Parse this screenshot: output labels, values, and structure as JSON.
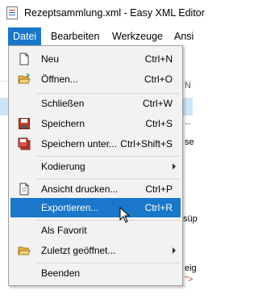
{
  "window": {
    "title": "Rezeptsammlung.xml - Easy XML Editor"
  },
  "menubar": {
    "items": [
      {
        "label": "Datei",
        "active": true
      },
      {
        "label": "Bearbeiten",
        "active": false
      },
      {
        "label": "Werkzeuge",
        "active": false
      },
      {
        "label": "Ansi",
        "active": false
      }
    ]
  },
  "background": {
    "snippets": [
      "N",
      "--",
      "se",
      "süp",
      "eig",
      "\">"
    ]
  },
  "menu": {
    "items": [
      {
        "label": "Neu",
        "shortcut": "Ctrl+N",
        "icon": "new-file-icon"
      },
      {
        "label": "Öffnen...",
        "shortcut": "Ctrl+O",
        "icon": "open-folder-icon"
      },
      {
        "label": "Schließen",
        "shortcut": "Ctrl+W"
      },
      {
        "label": "Speichern",
        "shortcut": "Ctrl+S",
        "icon": "save-icon"
      },
      {
        "label": "Speichern unter...",
        "shortcut": "Ctrl+Shift+S",
        "icon": "save-as-icon"
      },
      {
        "label": "Kodierung",
        "submenu": true
      },
      {
        "label": "Ansicht drucken...",
        "shortcut": "Ctrl+P",
        "icon": "print-preview-icon"
      },
      {
        "label": "Exportieren...",
        "shortcut": "Ctrl+R",
        "highlighted": true
      },
      {
        "label": "Als Favorit"
      },
      {
        "label": "Zuletzt geöffnet...",
        "submenu": true,
        "icon": "recent-folder-icon"
      },
      {
        "label": "Beenden"
      }
    ]
  },
  "colors": {
    "accent": "#1a77c9",
    "menu_bg": "#f2f2f2"
  }
}
